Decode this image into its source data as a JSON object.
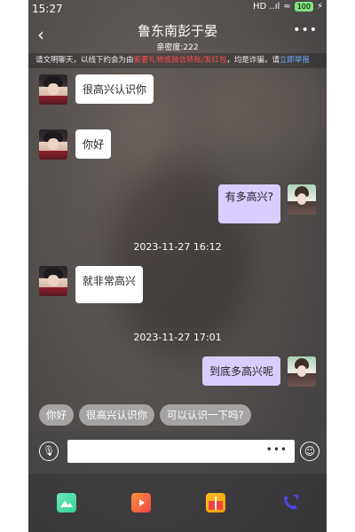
{
  "status": {
    "time": "15:27",
    "signal": "HD ..ıl",
    "wifi": "≈",
    "battery": "100"
  },
  "header": {
    "back": "‹",
    "title": "鲁东南彭于晏",
    "intimacy": "亲密度:222",
    "more": "•••"
  },
  "notice": {
    "part1": "请文明聊天，以线下约会为由",
    "red": "索要礼物或微信转账/发红包",
    "part2": "，均是诈骗，请",
    "link": "立即举报"
  },
  "messages": [
    {
      "side": "left",
      "text": "很高兴认识你"
    },
    {
      "side": "left",
      "text": "你好"
    },
    {
      "side": "right",
      "text": "有多高兴?"
    },
    {
      "side": "left",
      "text": "就非常高兴"
    },
    {
      "side": "right",
      "text": "到底多高兴呢"
    }
  ],
  "timestamps": [
    "2023-11-27 16:12",
    "2023-11-27 17:01"
  ],
  "quick_replies": [
    "你好",
    "很高兴认识你",
    "可以认识一下吗?"
  ],
  "input": {
    "dots": "•••"
  },
  "bottom_icons": [
    "image-icon",
    "video-icon",
    "gift-icon",
    "call-icon"
  ],
  "colors": {
    "my_bubble": "#d9ccff",
    "their_bubble": "#ffffff"
  }
}
